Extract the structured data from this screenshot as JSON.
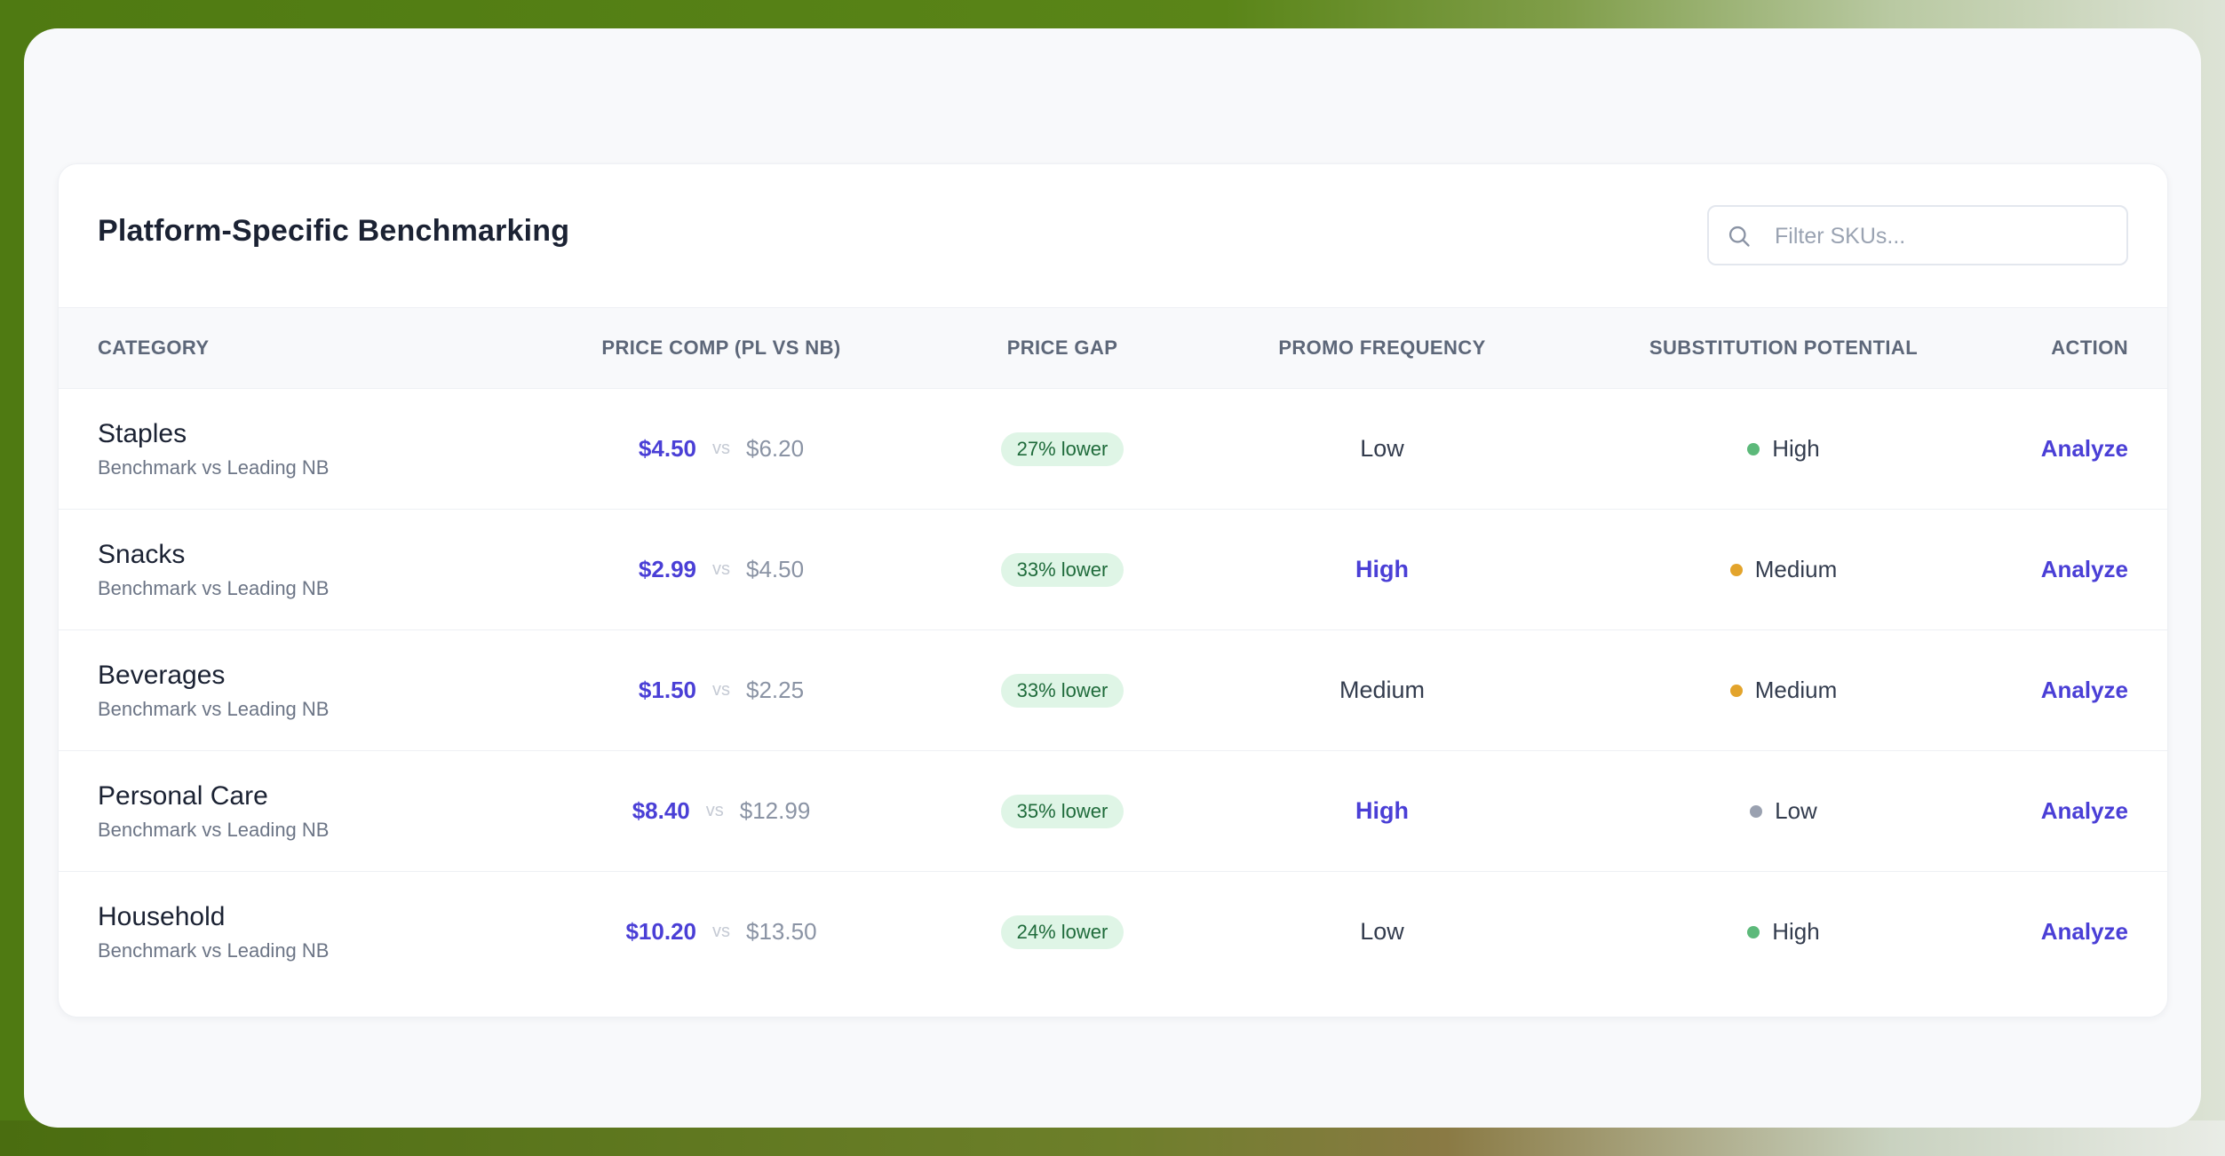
{
  "header": {
    "title": "Platform-Specific Benchmarking"
  },
  "search": {
    "placeholder": "Filter SKUs...",
    "value": ""
  },
  "table": {
    "columns": [
      "CATEGORY",
      "PRICE COMP (PL VS NB)",
      "PRICE GAP",
      "PROMO FREQUENCY",
      "SUBSTITUTION POTENTIAL",
      "ACTION"
    ],
    "vs_label": "vs",
    "rows": [
      {
        "category": "Staples",
        "subtitle": "Benchmark vs Leading NB",
        "pl_price": "$4.50",
        "nb_price": "$6.20",
        "gap": "27% lower",
        "promo": "Low",
        "promo_emphasis": false,
        "substitution": "High",
        "substitution_color": "#5cb97a",
        "action": "Analyze"
      },
      {
        "category": "Snacks",
        "subtitle": "Benchmark vs Leading NB",
        "pl_price": "$2.99",
        "nb_price": "$4.50",
        "gap": "33% lower",
        "promo": "High",
        "promo_emphasis": true,
        "substitution": "Medium",
        "substitution_color": "#e3a42c",
        "action": "Analyze"
      },
      {
        "category": "Beverages",
        "subtitle": "Benchmark vs Leading NB",
        "pl_price": "$1.50",
        "nb_price": "$2.25",
        "gap": "33% lower",
        "promo": "Medium",
        "promo_emphasis": false,
        "substitution": "Medium",
        "substitution_color": "#e3a42c",
        "action": "Analyze"
      },
      {
        "category": "Personal Care",
        "subtitle": "Benchmark vs Leading NB",
        "pl_price": "$8.40",
        "nb_price": "$12.99",
        "gap": "35% lower",
        "promo": "High",
        "promo_emphasis": true,
        "substitution": "Low",
        "substitution_color": "#9aa1b0",
        "action": "Analyze"
      },
      {
        "category": "Household",
        "subtitle": "Benchmark vs Leading NB",
        "pl_price": "$10.20",
        "nb_price": "$13.50",
        "gap": "24% lower",
        "promo": "Low",
        "promo_emphasis": false,
        "substitution": "High",
        "substitution_color": "#5cb97a",
        "action": "Analyze"
      }
    ]
  },
  "colors": {
    "accent": "#4a3fd6",
    "badge_bg": "#dff5e6",
    "badge_text": "#1f6b3b"
  }
}
